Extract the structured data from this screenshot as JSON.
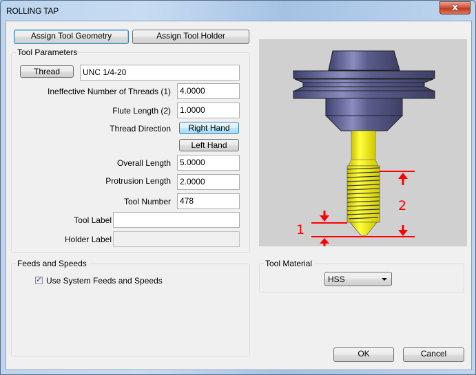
{
  "window": {
    "title": "ROLLING TAP",
    "close_glyph": "x"
  },
  "tabs": {
    "geometry_label": "Assign Tool Geometry",
    "holder_label": "Assign Tool Holder"
  },
  "tool_parameters": {
    "group_label": "Tool Parameters",
    "thread_button": "Thread",
    "thread_value": "UNC  1/4-20",
    "ineffective_threads": {
      "label": "Ineffective Number of Threads (1)",
      "value": "4.0000"
    },
    "flute_length": {
      "label": "Flute Length (2)",
      "value": "1.0000"
    },
    "thread_direction": {
      "label": "Thread Direction",
      "right_hand": "Right Hand",
      "left_hand": "Left Hand",
      "selected": "Right Hand"
    },
    "overall_length": {
      "label": "Overall Length",
      "value": "5.0000"
    },
    "protrusion_length": {
      "label": "Protrusion Length",
      "value": "2.0000"
    },
    "tool_number": {
      "label": "Tool Number",
      "value": "478"
    },
    "tool_label": {
      "label": "Tool Label",
      "value": ""
    },
    "holder_label": {
      "label": "Holder Label",
      "value": ""
    }
  },
  "preview": {
    "dimension_1": "1",
    "dimension_2": "2",
    "colors": {
      "holder": "#4f5180",
      "tool": "#e8e000",
      "dimension": "#ff0000",
      "background": "#d0d0d0"
    }
  },
  "feeds_speeds": {
    "group_label": "Feeds and Speeds",
    "use_system_label": "Use System Feeds and Speeds",
    "use_system_checked": true,
    "check_glyph": "✓"
  },
  "tool_material": {
    "group_label": "Tool Material",
    "selected": "HSS"
  },
  "footer": {
    "ok_label": "OK",
    "cancel_label": "Cancel"
  }
}
